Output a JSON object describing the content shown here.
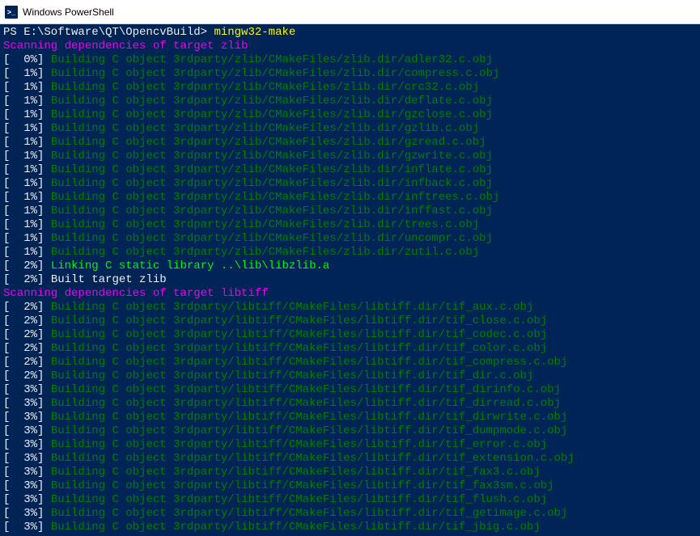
{
  "window": {
    "title": "Windows PowerShell",
    "icon_label": ">_"
  },
  "prompt": {
    "path": "PS E:\\Software\\QT\\OpencvBuild> ",
    "command": "mingw32-make"
  },
  "scan1": "Scanning dependencies of target zlib",
  "zlib": [
    {
      "pct": "  0%",
      "msg": "Building C object 3rdparty/zlib/CMakeFiles/zlib.dir/adler32.c.obj"
    },
    {
      "pct": "  1%",
      "msg": "Building C object 3rdparty/zlib/CMakeFiles/zlib.dir/compress.c.obj"
    },
    {
      "pct": "  1%",
      "msg": "Building C object 3rdparty/zlib/CMakeFiles/zlib.dir/crc32.c.obj"
    },
    {
      "pct": "  1%",
      "msg": "Building C object 3rdparty/zlib/CMakeFiles/zlib.dir/deflate.c.obj"
    },
    {
      "pct": "  1%",
      "msg": "Building C object 3rdparty/zlib/CMakeFiles/zlib.dir/gzclose.c.obj"
    },
    {
      "pct": "  1%",
      "msg": "Building C object 3rdparty/zlib/CMakeFiles/zlib.dir/gzlib.c.obj"
    },
    {
      "pct": "  1%",
      "msg": "Building C object 3rdparty/zlib/CMakeFiles/zlib.dir/gzread.c.obj"
    },
    {
      "pct": "  1%",
      "msg": "Building C object 3rdparty/zlib/CMakeFiles/zlib.dir/gzwrite.c.obj"
    },
    {
      "pct": "  1%",
      "msg": "Building C object 3rdparty/zlib/CMakeFiles/zlib.dir/inflate.c.obj"
    },
    {
      "pct": "  1%",
      "msg": "Building C object 3rdparty/zlib/CMakeFiles/zlib.dir/infback.c.obj"
    },
    {
      "pct": "  1%",
      "msg": "Building C object 3rdparty/zlib/CMakeFiles/zlib.dir/inftrees.c.obj"
    },
    {
      "pct": "  1%",
      "msg": "Building C object 3rdparty/zlib/CMakeFiles/zlib.dir/inffast.c.obj"
    },
    {
      "pct": "  1%",
      "msg": "Building C object 3rdparty/zlib/CMakeFiles/zlib.dir/trees.c.obj"
    },
    {
      "pct": "  1%",
      "msg": "Building C object 3rdparty/zlib/CMakeFiles/zlib.dir/uncompr.c.obj"
    },
    {
      "pct": "  1%",
      "msg": "Building C object 3rdparty/zlib/CMakeFiles/zlib.dir/zutil.c.obj"
    }
  ],
  "link": {
    "pct": "  2%",
    "msg": "Linking C static library ..\\lib\\libzlib.a"
  },
  "built": {
    "pct": "  2%",
    "msg": "Built target zlib"
  },
  "scan2": "Scanning dependencies of target libtiff",
  "libtiff": [
    {
      "pct": "  2%",
      "msg": "Building C object 3rdparty/libtiff/CMakeFiles/libtiff.dir/tif_aux.c.obj"
    },
    {
      "pct": "  2%",
      "msg": "Building C object 3rdparty/libtiff/CMakeFiles/libtiff.dir/tif_close.c.obj"
    },
    {
      "pct": "  2%",
      "msg": "Building C object 3rdparty/libtiff/CMakeFiles/libtiff.dir/tif_codec.c.obj"
    },
    {
      "pct": "  2%",
      "msg": "Building C object 3rdparty/libtiff/CMakeFiles/libtiff.dir/tif_color.c.obj"
    },
    {
      "pct": "  2%",
      "msg": "Building C object 3rdparty/libtiff/CMakeFiles/libtiff.dir/tif_compress.c.obj"
    },
    {
      "pct": "  2%",
      "msg": "Building C object 3rdparty/libtiff/CMakeFiles/libtiff.dir/tif_dir.c.obj"
    },
    {
      "pct": "  3%",
      "msg": "Building C object 3rdparty/libtiff/CMakeFiles/libtiff.dir/tif_dirinfo.c.obj"
    },
    {
      "pct": "  3%",
      "msg": "Building C object 3rdparty/libtiff/CMakeFiles/libtiff.dir/tif_dirread.c.obj"
    },
    {
      "pct": "  3%",
      "msg": "Building C object 3rdparty/libtiff/CMakeFiles/libtiff.dir/tif_dirwrite.c.obj"
    },
    {
      "pct": "  3%",
      "msg": "Building C object 3rdparty/libtiff/CMakeFiles/libtiff.dir/tif_dumpmode.c.obj"
    },
    {
      "pct": "  3%",
      "msg": "Building C object 3rdparty/libtiff/CMakeFiles/libtiff.dir/tif_error.c.obj"
    },
    {
      "pct": "  3%",
      "msg": "Building C object 3rdparty/libtiff/CMakeFiles/libtiff.dir/tif_extension.c.obj"
    },
    {
      "pct": "  3%",
      "msg": "Building C object 3rdparty/libtiff/CMakeFiles/libtiff.dir/tif_fax3.c.obj"
    },
    {
      "pct": "  3%",
      "msg": "Building C object 3rdparty/libtiff/CMakeFiles/libtiff.dir/tif_fax3sm.c.obj"
    },
    {
      "pct": "  3%",
      "msg": "Building C object 3rdparty/libtiff/CMakeFiles/libtiff.dir/tif_flush.c.obj"
    },
    {
      "pct": "  3%",
      "msg": "Building C object 3rdparty/libtiff/CMakeFiles/libtiff.dir/tif_getimage.c.obj"
    },
    {
      "pct": "  3%",
      "msg": "Building C object 3rdparty/libtiff/CMakeFiles/libtiff.dir/tif_jbig.c.obj"
    }
  ]
}
